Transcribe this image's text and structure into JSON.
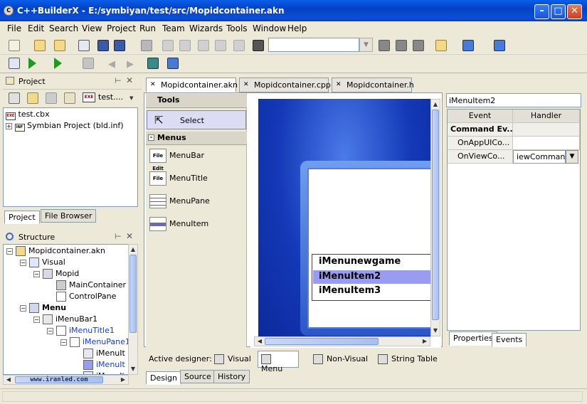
{
  "window": {
    "title": "C++BuilderX - E:/symbiyan/test/src/Mopidcontainer.akn",
    "app_icon": "C",
    "controls": {
      "minimize": "–",
      "maximize": "□",
      "close": "✕"
    }
  },
  "menubar": [
    "File",
    "Edit",
    "Search",
    "View",
    "Project",
    "Run",
    "Team",
    "Wizards",
    "Tools",
    "Window",
    "Help"
  ],
  "toolbar": {
    "search_value": ""
  },
  "project_panel": {
    "title": "Project",
    "project_selector": "test....",
    "tree": [
      {
        "label": "test.cbx",
        "icon": "exe-icon"
      },
      {
        "label": "Symbian Project (bld.inf)",
        "icon": "inf-icon"
      }
    ],
    "tabs": [
      "Project",
      "File Browser"
    ]
  },
  "structure_panel": {
    "title": "Structure",
    "tree": [
      {
        "label": "Mopidcontainer.akn",
        "depth": 0,
        "bold": false
      },
      {
        "label": "Visual",
        "depth": 1,
        "bold": false
      },
      {
        "label": "Mopid",
        "depth": 2,
        "bold": false
      },
      {
        "label": "MainContainer",
        "depth": 3,
        "bold": false
      },
      {
        "label": "ControlPane",
        "depth": 3,
        "bold": false
      },
      {
        "label": "Menu",
        "depth": 1,
        "bold": true
      },
      {
        "label": "iMenuBar1",
        "depth": 2,
        "bold": false
      },
      {
        "label": "iMenuTitle1",
        "depth": 3,
        "bold": false,
        "link": true
      },
      {
        "label": "iMenuPane1",
        "depth": 4,
        "bold": false,
        "link": true
      },
      {
        "label": "iMenuIt",
        "depth": 5,
        "bold": false
      },
      {
        "label": "iMenuIt",
        "depth": 5,
        "bold": false,
        "link": true
      },
      {
        "label": "iMenuIt",
        "depth": 5,
        "bold": false
      }
    ],
    "watermark": "www.iranled.com"
  },
  "editor_tabs": [
    {
      "label": "Mopidcontainer.akn",
      "active": true
    },
    {
      "label": "Mopidcontainer.cpp",
      "active": false
    },
    {
      "label": "Mopidcontainer.h",
      "active": false
    }
  ],
  "palette": {
    "tools_header": "Tools",
    "select_label": "Select",
    "menus_header": "Menus",
    "items": [
      {
        "label": "MenuBar",
        "icon_text": "File Edit"
      },
      {
        "label": "MenuTitle",
        "icon_text": "File"
      },
      {
        "label": "MenuPane",
        "icon_text": ""
      },
      {
        "label": "MenuItem",
        "icon_text": ""
      }
    ]
  },
  "design_menu": {
    "items": [
      "iMenunewgame",
      "iMenuItem2",
      "iMenuItem3"
    ],
    "selected_index": 1
  },
  "inspector": {
    "component_name": "iMenuItem2",
    "columns": [
      "Event",
      "Handler"
    ],
    "group": "Command Ev...",
    "rows": [
      {
        "event": "OnAppUICo...",
        "handler": ""
      },
      {
        "event": "OnViewCo...",
        "handler": "iewCommandL"
      }
    ],
    "tabs": [
      "Properties",
      "Events"
    ],
    "active_tab": "Events"
  },
  "designer_bar": {
    "label": "Active designer:",
    "buttons": [
      "Visual",
      "Menu",
      "Non-Visual",
      "String Table"
    ],
    "active": "Menu"
  },
  "bottom_tabs": [
    "Design",
    "Source",
    "History"
  ],
  "colors": {
    "titlebar": "#0a5ee8",
    "selection": "#9a9cf0",
    "canvas": "#1438b8"
  }
}
